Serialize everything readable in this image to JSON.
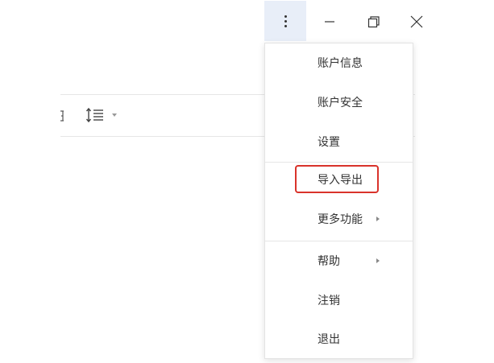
{
  "window_controls": {
    "more_icon": "more-vertical-icon",
    "minimize_icon": "minimize-icon",
    "restore_icon": "restore-icon",
    "close_icon": "close-icon"
  },
  "toolbar": {
    "line_spacing_icon": "line-spacing-icon",
    "dropdown_icon": "caret-down-icon"
  },
  "menu": {
    "items": [
      {
        "label": "账户信息"
      },
      {
        "label": "账户安全"
      },
      {
        "label": "设置"
      },
      {
        "label": "导入导出",
        "highlighted": true
      },
      {
        "label": "更多功能",
        "has_submenu": true
      },
      {
        "label": "帮助",
        "has_submenu": true
      },
      {
        "label": "注销"
      },
      {
        "label": "退出"
      }
    ]
  },
  "colors": {
    "highlight_border": "#d9332b",
    "more_button_bg": "#e8eef8"
  }
}
